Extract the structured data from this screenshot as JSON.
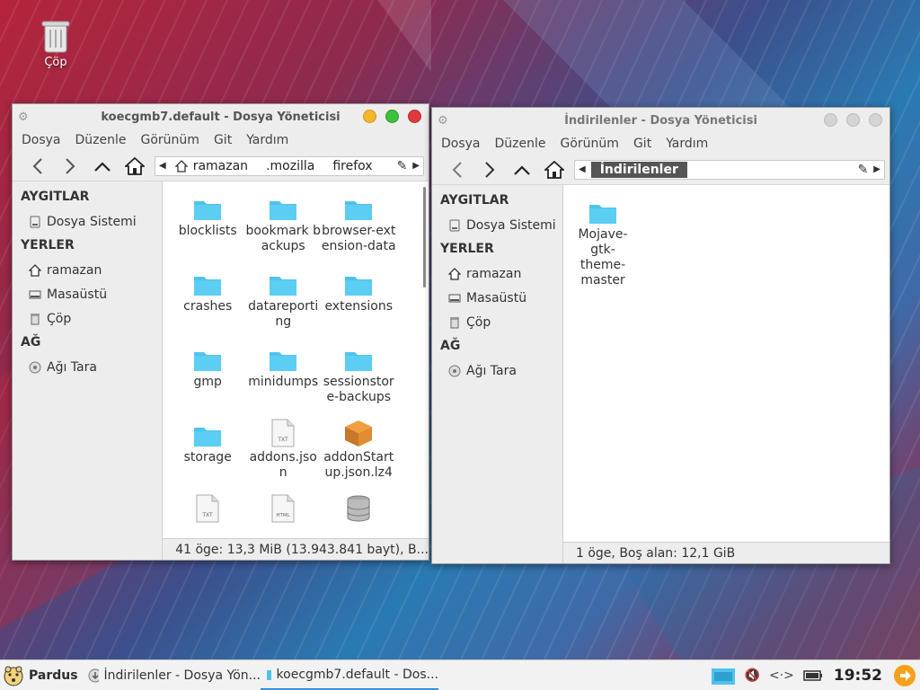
{
  "desktop": {
    "trash_label": "Çöp"
  },
  "window_left": {
    "title": "koecgmb7.default - Dosya Yöneticisi",
    "menu": [
      "Dosya",
      "Düzenle",
      "Görünüm",
      "Git",
      "Yardım"
    ],
    "path": [
      "ramazan",
      ".mozilla",
      "firefox"
    ],
    "sidebar": {
      "devices_header": "AYGITLAR",
      "filesystem": "Dosya Sistemi",
      "places_header": "YERLER",
      "home": "ramazan",
      "desktop": "Masaüstü",
      "trash": "Çöp",
      "network_header": "AĞ",
      "browse_network": "Ağı Tara"
    },
    "files": [
      {
        "name": "blocklists",
        "icon": "folder-icon"
      },
      {
        "name": "bookmark backups",
        "icon": "folder-icon"
      },
      {
        "name": "browser-extension-data",
        "icon": "folder-icon"
      },
      {
        "name": "crashes",
        "icon": "folder-icon"
      },
      {
        "name": "datareporting",
        "icon": "folder-icon"
      },
      {
        "name": "extensions",
        "icon": "folder-icon"
      },
      {
        "name": "gmp",
        "icon": "folder-icon"
      },
      {
        "name": "minidumps",
        "icon": "folder-icon"
      },
      {
        "name": "sessionstore-backups",
        "icon": "folder-icon"
      },
      {
        "name": "storage",
        "icon": "folder-icon"
      },
      {
        "name": "addons.json",
        "icon": "txt-file-icon"
      },
      {
        "name": "addonStartup.json.lz4",
        "icon": "package-icon"
      },
      {
        "name": "",
        "icon": "txt-file-icon"
      },
      {
        "name": "",
        "icon": "html-file-icon"
      },
      {
        "name": "",
        "icon": "database-icon"
      }
    ],
    "status": "41 öge: 13,3 MiB (13.943.841 bayt), B..."
  },
  "window_right": {
    "title": "İndirilenler - Dosya Yöneticisi",
    "menu": [
      "Dosya",
      "Düzenle",
      "Görünüm",
      "Git",
      "Yardım"
    ],
    "path": [
      "İndirilenler"
    ],
    "sidebar": {
      "devices_header": "AYGITLAR",
      "filesystem": "Dosya Sistemi",
      "places_header": "YERLER",
      "home": "ramazan",
      "desktop": "Masaüstü",
      "trash": "Çöp",
      "network_header": "AĞ",
      "browse_network": "Ağı Tara"
    },
    "files": [
      {
        "name": "Mojave-gtk-theme-master",
        "icon": "folder-icon"
      }
    ],
    "status": "1 öge, Boş alan: 12,1 GiB"
  },
  "taskbar": {
    "start_label": "Pardus",
    "tasks": [
      {
        "label": "İndirilenler - Dosya Yön...",
        "active": false
      },
      {
        "label": "koecgmb7.default - Dos...",
        "active": true
      }
    ],
    "clock": "19:52"
  },
  "colors": {
    "folder": "#4fc3ec",
    "accent": "#3b8ed6",
    "close": "#e0393e",
    "maximize": "#3cc13b",
    "minimize": "#f5b52e"
  }
}
